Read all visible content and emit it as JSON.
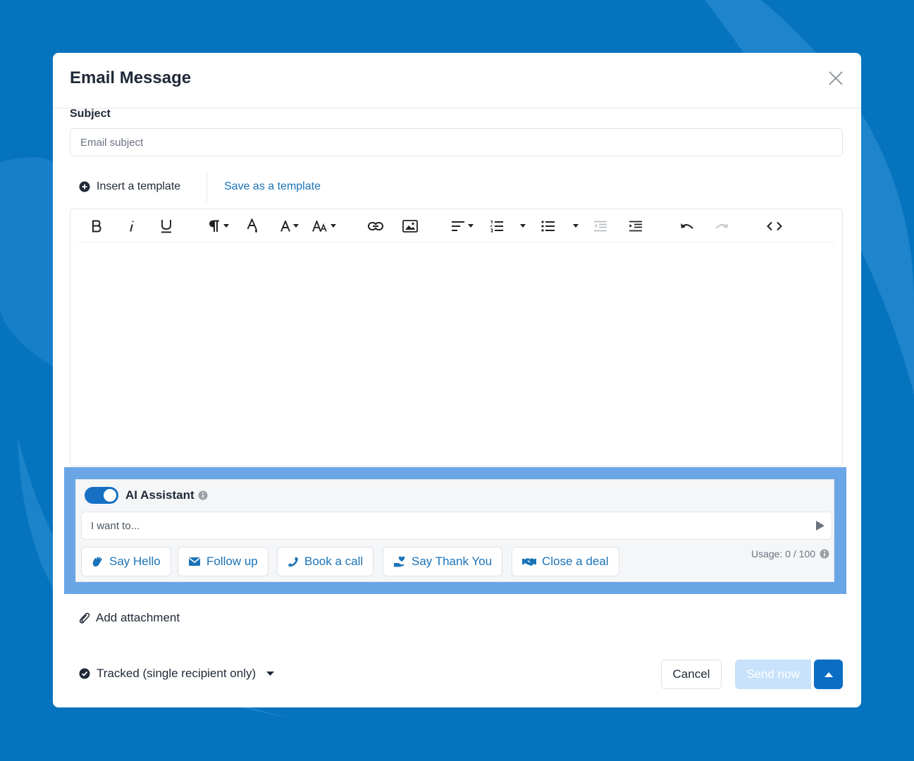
{
  "modal": {
    "title": "Email Message",
    "subject_label": "Subject",
    "subject_placeholder": "Email subject",
    "insert_template": "Insert a template",
    "save_template": "Save as a template"
  },
  "toolbar": {
    "items": [
      "bold-icon",
      "italic-icon",
      "underline-icon",
      "paragraph-icon",
      "text-color-icon",
      "font-family-icon",
      "font-size-icon",
      "link-icon",
      "image-icon",
      "align-icon",
      "ordered-list-icon",
      "unordered-list-icon",
      "outdent-icon",
      "indent-icon",
      "undo-icon",
      "redo-icon",
      "code-view-icon"
    ]
  },
  "ai_assistant": {
    "title": "AI Assistant",
    "enabled": true,
    "input_placeholder": "I want to...",
    "chips": [
      {
        "label": "Say Hello",
        "icon": "wave-hand-icon"
      },
      {
        "label": "Follow up",
        "icon": "envelope-icon"
      },
      {
        "label": "Book a call",
        "icon": "phone-icon"
      },
      {
        "label": "Say Thank You",
        "icon": "hand-heart-icon"
      },
      {
        "label": "Close a deal",
        "icon": "handshake-icon"
      }
    ],
    "usage": "Usage: 0 / 100"
  },
  "footer": {
    "add_attachment": "Add attachment",
    "tracked": "Tracked (single recipient only)",
    "cancel": "Cancel",
    "send_now": "Send now"
  },
  "colors": {
    "background": "#0573bd",
    "accent": "#1a73b8",
    "highlight": "#6aa6e6",
    "send_disabled": "#c8e2fb",
    "send_more": "#0b6ec5"
  }
}
